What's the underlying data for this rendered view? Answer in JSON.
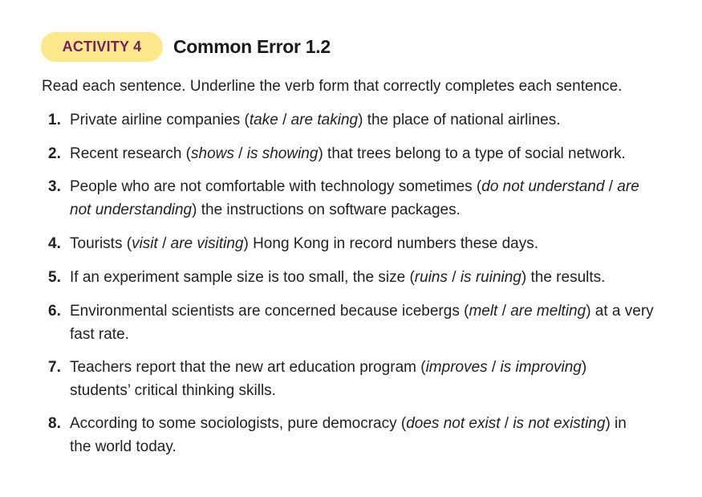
{
  "header": {
    "badge": "ACTIVITY 4",
    "title": "Common Error 1.2"
  },
  "instructions": "Read each sentence. Underline the verb form that correctly completes each sentence.",
  "items": [
    {
      "num": "1.",
      "before": "Private airline companies (",
      "opt1": "take",
      "sep": " / ",
      "opt2": "are taking",
      "after": ") the place of national airlines."
    },
    {
      "num": "2.",
      "before": "Recent research (",
      "opt1": "shows",
      "sep": " / ",
      "opt2": "is showing",
      "after": ") that trees belong to a type of social network."
    },
    {
      "num": "3.",
      "before": "People who are not comfortable with technology sometimes (",
      "opt1": "do not understand",
      "sep": " / ",
      "opt2": "are not understanding",
      "after": ") the instructions on software packages."
    },
    {
      "num": "4.",
      "before": "Tourists (",
      "opt1": "visit",
      "sep": " / ",
      "opt2": "are visiting",
      "after": ") Hong Kong in record numbers these days."
    },
    {
      "num": "5.",
      "before": "If an experiment sample size is too small, the size (",
      "opt1": "ruins",
      "sep": " / ",
      "opt2": "is ruining",
      "after": ") the results."
    },
    {
      "num": "6.",
      "before": "Environmental scientists are concerned because icebergs (",
      "opt1": "melt",
      "sep": " / ",
      "opt2": "are melting",
      "after": ") at a very fast rate."
    },
    {
      "num": "7.",
      "before": "Teachers report that the new art education program (",
      "opt1": "improves",
      "sep": " / ",
      "opt2": "is improving",
      "after": ") students’ critical thinking skills."
    },
    {
      "num": "8.",
      "before": "According to some sociologists, pure democracy (",
      "opt1": "does not exist",
      "sep": " / ",
      "opt2": "is not existing",
      "after": ") in the world today."
    }
  ]
}
